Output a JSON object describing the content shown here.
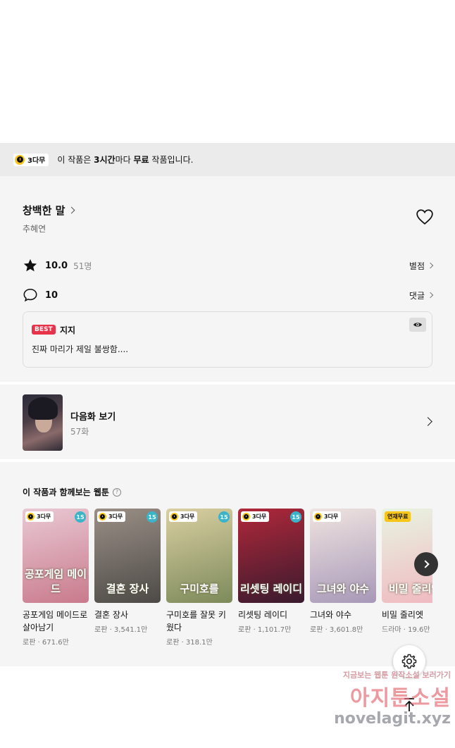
{
  "banner": {
    "badge": "3다무",
    "text_prefix": "이 작품은 ",
    "text_bold1": "3시간",
    "text_mid": "마다 ",
    "text_bold2": "무료",
    "text_suffix": " 작품입니다."
  },
  "work": {
    "title": "창백한 말",
    "author": "추혜연",
    "rating": "10.0",
    "rating_count": "51명",
    "rating_link": "별점",
    "comment_count": "10",
    "comment_link": "댓글",
    "best": {
      "badge": "BEST",
      "user": "지지",
      "text": "진짜 마리가 제일 불쌍함...."
    }
  },
  "next_episode": {
    "label": "다음화 보기",
    "episode": "57화"
  },
  "recommend": {
    "title": "이 작품과 함께보는 웹툰",
    "help": "?",
    "items": [
      {
        "badge": "3다무",
        "age": "15",
        "cover_title": "공포게임 메이드",
        "name": "공포게임 메이드로 살아남기",
        "meta": "로판 · 671.6만",
        "colors": [
          "#e9c9d4",
          "#c97a8c"
        ]
      },
      {
        "badge": "3다무",
        "age": "15",
        "cover_title": "결혼 장사",
        "name": "결혼 장사",
        "meta": "로판 · 3,541.1만",
        "colors": [
          "#9a8f86",
          "#4d4a47"
        ]
      },
      {
        "badge": "3다무",
        "age": "15",
        "cover_title": "구미호를",
        "name": "구미호를 잘못 키웠다",
        "meta": "로판 · 318.1만",
        "colors": [
          "#d9cfa2",
          "#7d8a5a"
        ]
      },
      {
        "badge": "3다무",
        "age": "15",
        "cover_title": "리셋팅 레이디",
        "name": "리셋팅 레이디",
        "meta": "로판 · 1,101.7만",
        "colors": [
          "#b0283a",
          "#3a1a2e"
        ]
      },
      {
        "badge": "3다무",
        "age": "",
        "cover_title": "그녀와 야수",
        "name": "그녀와 야수",
        "meta": "로판 · 3,601.8만",
        "colors": [
          "#efe4e0",
          "#a898b8"
        ]
      },
      {
        "badge": "연재무료",
        "age": "",
        "cover_title": "비밀 줄리엣",
        "name": "비밀 줄리엣",
        "meta": "드라마 · 19.6만",
        "colors": [
          "#e8f4e2",
          "#f0b8c0"
        ]
      }
    ]
  },
  "watermark": {
    "line1": "지금보는 웹툰 원작소설 보러가기",
    "line2": "아지툰소설",
    "line3": "novelagit.xyz"
  }
}
